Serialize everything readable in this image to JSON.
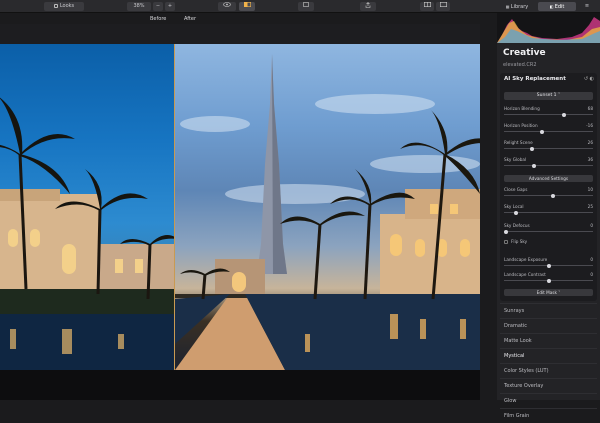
{
  "toolbar": {
    "looks_label": "Looks",
    "zoom_value": "38%",
    "zoom_minus": "−",
    "zoom_plus": "+",
    "library_label": "Library",
    "edit_label": "Edit"
  },
  "compare": {
    "before_label": "Before",
    "after_label": "After"
  },
  "panel": {
    "title": "Creative",
    "filename": "elevated.CR2",
    "section_title": "AI Sky Replacement",
    "sky_dropdown": "Sunset 1 ˅",
    "sliders_a": [
      {
        "label": "Horizon Blending",
        "value": "68",
        "pos": 0.68
      },
      {
        "label": "Horizon Position",
        "value": "-16",
        "pos": 0.42
      },
      {
        "label": "Relight Scene",
        "value": "26",
        "pos": 0.3
      },
      {
        "label": "Sky Global",
        "value": "36",
        "pos": 0.33
      }
    ],
    "advanced_label": "Advanced Settings",
    "sliders_b": [
      {
        "label": "Close Gaps",
        "value": "10",
        "pos": 0.55
      },
      {
        "label": "Sky Local",
        "value": "25",
        "pos": 0.12
      }
    ],
    "sky_defocus": {
      "label": "Sky Defocus",
      "value": "0",
      "pos": 0.0
    },
    "flip_sky_label": "Flip Sky",
    "landscape_exposure": {
      "label": "Landscape Exposure",
      "value": "0",
      "pos": 0.5
    },
    "landscape_contrast": {
      "label": "Landscape Contrast",
      "value": "0",
      "pos": 0.5
    },
    "edit_mask_label": "Edit Mask ˅",
    "list": [
      "Sunrays",
      "Dramatic",
      "Matte Look",
      "Mystical",
      "Color Styles (LUT)",
      "Texture Overlay",
      "Glow",
      "Film Grain"
    ]
  },
  "colors": {
    "accent": "#c99a52",
    "panel_bg": "#232326"
  }
}
